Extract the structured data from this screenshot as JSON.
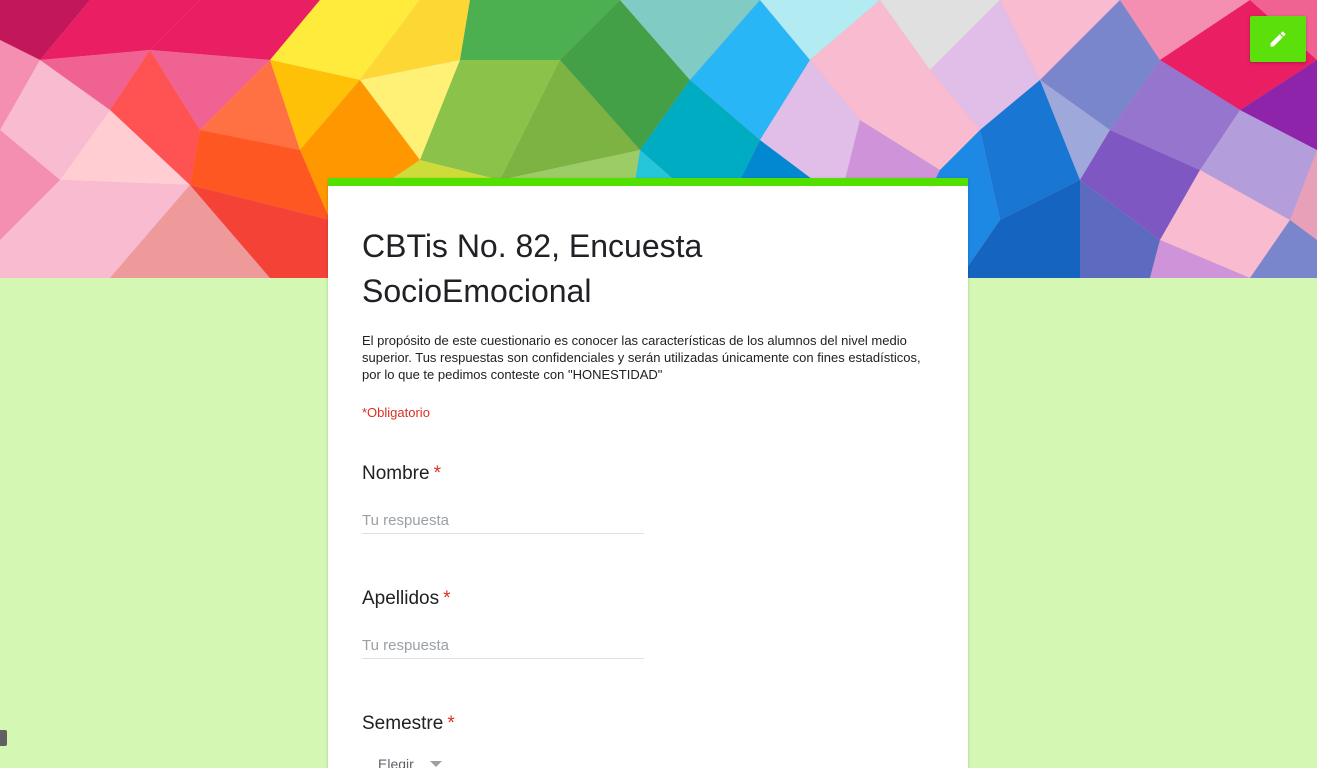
{
  "header": {
    "edit_icon": "pencil-icon",
    "accent_color": "#5be00c"
  },
  "form": {
    "title": "CBTis No. 82, Encuesta SocioEmocional",
    "description": "El propósito de este cuestionario es conocer las características de los alumnos del nivel medio superior. Tus respuestas son confidenciales y serán utilizadas únicamente con fines estadísticos, por lo que te pedimos conteste con \"HONESTIDAD\"",
    "required_note": "*Obligatorio",
    "top_border_color": "#52e000",
    "background_color": "#d5f7b4"
  },
  "questions": [
    {
      "title": "Nombre",
      "required_mark": "*",
      "placeholder": "Tu respuesta"
    },
    {
      "title": "Apellidos",
      "required_mark": "*",
      "placeholder": "Tu respuesta"
    },
    {
      "title": "Semestre",
      "required_mark": "*",
      "select_value": "Elegir",
      "select_icon": "chevron-down-icon"
    }
  ]
}
